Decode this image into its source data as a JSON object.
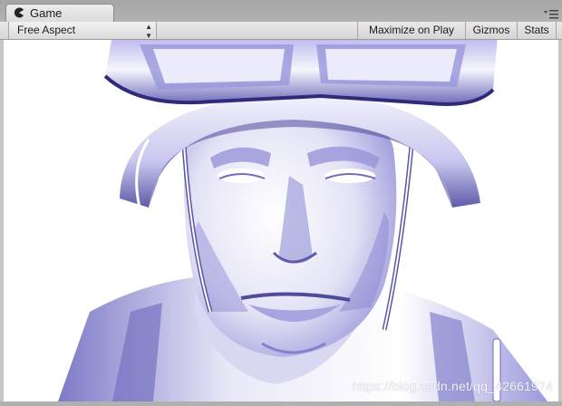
{
  "tab": {
    "label": "Game",
    "icon": "pacman-icon",
    "menu_icon": "panel-menu-icon"
  },
  "toolbar": {
    "aspect_label": "Free Aspect",
    "maximize_label": "Maximize on Play",
    "gizmos_label": "Gizmos",
    "stats_label": "Stats"
  },
  "viewport": {
    "content": "soldier-head-render",
    "shading_color": "#8a86d8",
    "background": "#ffffff"
  },
  "watermark": {
    "text": "https://blog.csdn.net/qq_42661974"
  }
}
